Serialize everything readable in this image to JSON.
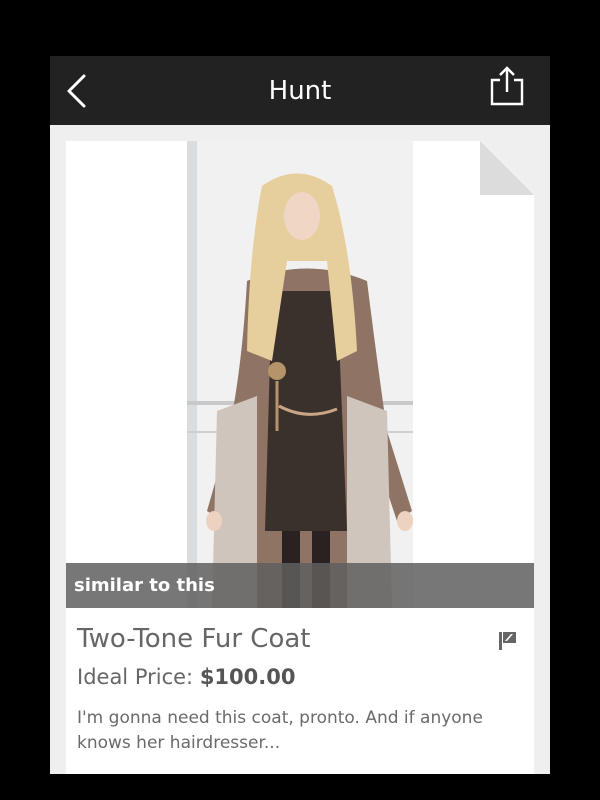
{
  "header": {
    "title": "Hunt",
    "back_icon": "back-chevron-icon",
    "share_icon": "share-icon"
  },
  "item": {
    "image_label": "similar to this",
    "name": "Two-Tone Fur Coat",
    "price_label": "Ideal Price: ",
    "price_value": "$100.00",
    "description": "I'm gonna need this coat, pronto. And if anyone knows her hairdresser...",
    "flag_icon": "flag-icon"
  },
  "colors": {
    "navbar": "#222222",
    "background": "#efefef",
    "overlay": "#5f5f5f"
  }
}
